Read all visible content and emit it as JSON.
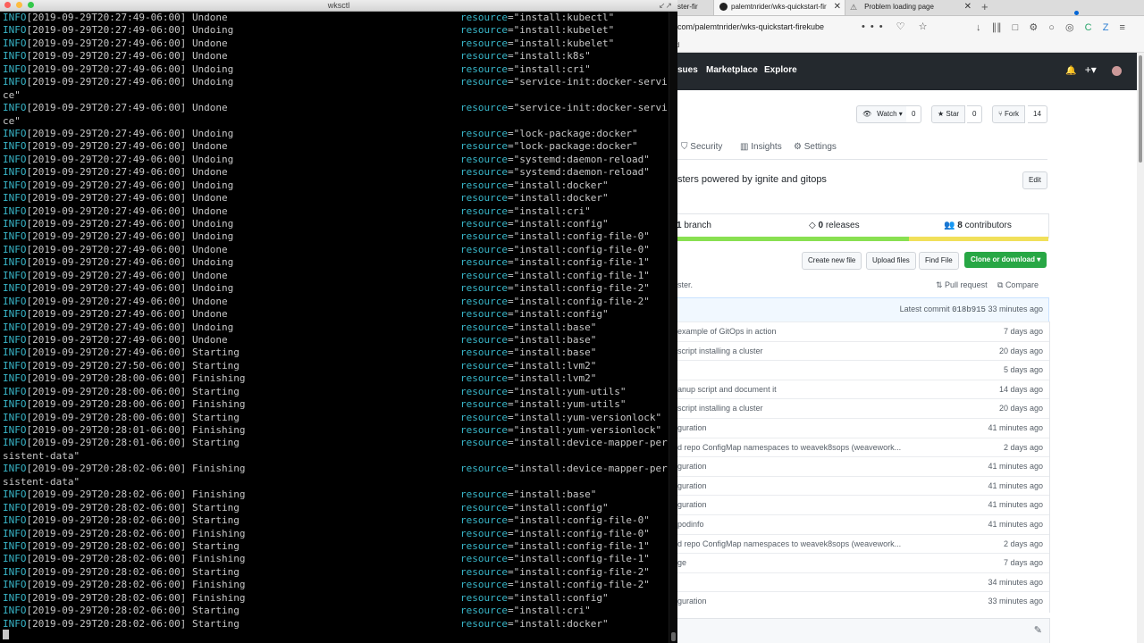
{
  "terminal": {
    "title": "wksctl",
    "resize_glyph": "↙↗",
    "lines": [
      {
        "level": "INFO",
        "ts": "[2019-09-29T20:27:49-06:00]",
        "msg": "Undone",
        "res_key": "resource",
        "res_val": "=\"install:kubectl\""
      },
      {
        "level": "INFO",
        "ts": "[2019-09-29T20:27:49-06:00]",
        "msg": "Undoing",
        "res_key": "resource",
        "res_val": "=\"install:kubelet\""
      },
      {
        "level": "INFO",
        "ts": "[2019-09-29T20:27:49-06:00]",
        "msg": "Undone",
        "res_key": "resource",
        "res_val": "=\"install:kubelet\""
      },
      {
        "level": "INFO",
        "ts": "[2019-09-29T20:27:49-06:00]",
        "msg": "Undone",
        "res_key": "resource",
        "res_val": "=\"install:k8s\""
      },
      {
        "level": "INFO",
        "ts": "[2019-09-29T20:27:49-06:00]",
        "msg": "Undoing",
        "res_key": "resource",
        "res_val": "=\"install:cri\""
      },
      {
        "level": "INFO",
        "ts": "[2019-09-29T20:27:49-06:00]",
        "msg": "Undoing",
        "res_key": "resource",
        "res_val": "=\"service-init:docker-servi"
      },
      {
        "level": "",
        "ts": "",
        "msg": "ce\"",
        "res_key": "",
        "res_val": ""
      },
      {
        "level": "INFO",
        "ts": "[2019-09-29T20:27:49-06:00]",
        "msg": "Undone",
        "res_key": "resource",
        "res_val": "=\"service-init:docker-servi"
      },
      {
        "level": "",
        "ts": "",
        "msg": "ce\"",
        "res_key": "",
        "res_val": ""
      },
      {
        "level": "INFO",
        "ts": "[2019-09-29T20:27:49-06:00]",
        "msg": "Undoing",
        "res_key": "resource",
        "res_val": "=\"lock-package:docker\""
      },
      {
        "level": "INFO",
        "ts": "[2019-09-29T20:27:49-06:00]",
        "msg": "Undone",
        "res_key": "resource",
        "res_val": "=\"lock-package:docker\""
      },
      {
        "level": "INFO",
        "ts": "[2019-09-29T20:27:49-06:00]",
        "msg": "Undoing",
        "res_key": "resource",
        "res_val": "=\"systemd:daemon-reload\""
      },
      {
        "level": "INFO",
        "ts": "[2019-09-29T20:27:49-06:00]",
        "msg": "Undone",
        "res_key": "resource",
        "res_val": "=\"systemd:daemon-reload\""
      },
      {
        "level": "INFO",
        "ts": "[2019-09-29T20:27:49-06:00]",
        "msg": "Undoing",
        "res_key": "resource",
        "res_val": "=\"install:docker\""
      },
      {
        "level": "INFO",
        "ts": "[2019-09-29T20:27:49-06:00]",
        "msg": "Undone",
        "res_key": "resource",
        "res_val": "=\"install:docker\""
      },
      {
        "level": "INFO",
        "ts": "[2019-09-29T20:27:49-06:00]",
        "msg": "Undone",
        "res_key": "resource",
        "res_val": "=\"install:cri\""
      },
      {
        "level": "INFO",
        "ts": "[2019-09-29T20:27:49-06:00]",
        "msg": "Undoing",
        "res_key": "resource",
        "res_val": "=\"install:config\""
      },
      {
        "level": "INFO",
        "ts": "[2019-09-29T20:27:49-06:00]",
        "msg": "Undoing",
        "res_key": "resource",
        "res_val": "=\"install:config-file-0\""
      },
      {
        "level": "INFO",
        "ts": "[2019-09-29T20:27:49-06:00]",
        "msg": "Undone",
        "res_key": "resource",
        "res_val": "=\"install:config-file-0\""
      },
      {
        "level": "INFO",
        "ts": "[2019-09-29T20:27:49-06:00]",
        "msg": "Undoing",
        "res_key": "resource",
        "res_val": "=\"install:config-file-1\""
      },
      {
        "level": "INFO",
        "ts": "[2019-09-29T20:27:49-06:00]",
        "msg": "Undone",
        "res_key": "resource",
        "res_val": "=\"install:config-file-1\""
      },
      {
        "level": "INFO",
        "ts": "[2019-09-29T20:27:49-06:00]",
        "msg": "Undoing",
        "res_key": "resource",
        "res_val": "=\"install:config-file-2\""
      },
      {
        "level": "INFO",
        "ts": "[2019-09-29T20:27:49-06:00]",
        "msg": "Undone",
        "res_key": "resource",
        "res_val": "=\"install:config-file-2\""
      },
      {
        "level": "INFO",
        "ts": "[2019-09-29T20:27:49-06:00]",
        "msg": "Undone",
        "res_key": "resource",
        "res_val": "=\"install:config\""
      },
      {
        "level": "INFO",
        "ts": "[2019-09-29T20:27:49-06:00]",
        "msg": "Undoing",
        "res_key": "resource",
        "res_val": "=\"install:base\""
      },
      {
        "level": "INFO",
        "ts": "[2019-09-29T20:27:49-06:00]",
        "msg": "Undone",
        "res_key": "resource",
        "res_val": "=\"install:base\""
      },
      {
        "level": "INFO",
        "ts": "[2019-09-29T20:27:49-06:00]",
        "msg": "Starting",
        "res_key": "resource",
        "res_val": "=\"install:base\""
      },
      {
        "level": "INFO",
        "ts": "[2019-09-29T20:27:50-06:00]",
        "msg": "Starting",
        "res_key": "resource",
        "res_val": "=\"install:lvm2\""
      },
      {
        "level": "INFO",
        "ts": "[2019-09-29T20:28:00-06:00]",
        "msg": "Finishing",
        "res_key": "resource",
        "res_val": "=\"install:lvm2\""
      },
      {
        "level": "INFO",
        "ts": "[2019-09-29T20:28:00-06:00]",
        "msg": "Starting",
        "res_key": "resource",
        "res_val": "=\"install:yum-utils\""
      },
      {
        "level": "INFO",
        "ts": "[2019-09-29T20:28:00-06:00]",
        "msg": "Finishing",
        "res_key": "resource",
        "res_val": "=\"install:yum-utils\""
      },
      {
        "level": "INFO",
        "ts": "[2019-09-29T20:28:00-06:00]",
        "msg": "Starting",
        "res_key": "resource",
        "res_val": "=\"install:yum-versionlock\""
      },
      {
        "level": "INFO",
        "ts": "[2019-09-29T20:28:01-06:00]",
        "msg": "Finishing",
        "res_key": "resource",
        "res_val": "=\"install:yum-versionlock\""
      },
      {
        "level": "INFO",
        "ts": "[2019-09-29T20:28:01-06:00]",
        "msg": "Starting",
        "res_key": "resource",
        "res_val": "=\"install:device-mapper-per"
      },
      {
        "level": "",
        "ts": "",
        "msg": "sistent-data\"",
        "res_key": "",
        "res_val": ""
      },
      {
        "level": "INFO",
        "ts": "[2019-09-29T20:28:02-06:00]",
        "msg": "Finishing",
        "res_key": "resource",
        "res_val": "=\"install:device-mapper-per"
      },
      {
        "level": "",
        "ts": "",
        "msg": "sistent-data\"",
        "res_key": "",
        "res_val": ""
      },
      {
        "level": "INFO",
        "ts": "[2019-09-29T20:28:02-06:00]",
        "msg": "Finishing",
        "res_key": "resource",
        "res_val": "=\"install:base\""
      },
      {
        "level": "INFO",
        "ts": "[2019-09-29T20:28:02-06:00]",
        "msg": "Starting",
        "res_key": "resource",
        "res_val": "=\"install:config\""
      },
      {
        "level": "INFO",
        "ts": "[2019-09-29T20:28:02-06:00]",
        "msg": "Starting",
        "res_key": "resource",
        "res_val": "=\"install:config-file-0\""
      },
      {
        "level": "INFO",
        "ts": "[2019-09-29T20:28:02-06:00]",
        "msg": "Finishing",
        "res_key": "resource",
        "res_val": "=\"install:config-file-0\""
      },
      {
        "level": "INFO",
        "ts": "[2019-09-29T20:28:02-06:00]",
        "msg": "Starting",
        "res_key": "resource",
        "res_val": "=\"install:config-file-1\""
      },
      {
        "level": "INFO",
        "ts": "[2019-09-29T20:28:02-06:00]",
        "msg": "Finishing",
        "res_key": "resource",
        "res_val": "=\"install:config-file-1\""
      },
      {
        "level": "INFO",
        "ts": "[2019-09-29T20:28:02-06:00]",
        "msg": "Starting",
        "res_key": "resource",
        "res_val": "=\"install:config-file-2\""
      },
      {
        "level": "INFO",
        "ts": "[2019-09-29T20:28:02-06:00]",
        "msg": "Finishing",
        "res_key": "resource",
        "res_val": "=\"install:config-file-2\""
      },
      {
        "level": "INFO",
        "ts": "[2019-09-29T20:28:02-06:00]",
        "msg": "Finishing",
        "res_key": "resource",
        "res_val": "=\"install:config\""
      },
      {
        "level": "INFO",
        "ts": "[2019-09-29T20:28:02-06:00]",
        "msg": "Starting",
        "res_key": "resource",
        "res_val": "=\"install:cri\""
      },
      {
        "level": "INFO",
        "ts": "[2019-09-29T20:28:02-06:00]",
        "msg": "Starting",
        "res_key": "resource",
        "res_val": "=\"install:docker\""
      }
    ],
    "colors": {
      "background": "#000000",
      "text": "#c7c7c7",
      "accent": "#38b6c9"
    }
  },
  "browser": {
    "tabs": [
      {
        "label": "ster-fir",
        "icon": "tab-icon"
      },
      {
        "label": "palemtnrider/wks-quickstart-fir",
        "icon": "github-icon"
      },
      {
        "label": "Problem loading page",
        "icon": "warning-icon"
      }
    ],
    "tab_close": "✕",
    "new_tab": "+",
    "url": "com/palemtnrider/wks-quickstart-firekube",
    "url_actions": [
      "•••",
      "♡",
      "☆"
    ],
    "nav_icons": [
      "↓",
      "∥∥",
      "□",
      "⚙",
      "○",
      "◎",
      "C",
      "Z",
      "≡"
    ],
    "bookmarks_label": "d",
    "gh_nav": [
      "sues",
      "Marketplace",
      "Explore"
    ],
    "gh_right": [
      "🔔",
      "+▾",
      "▾"
    ],
    "watch": {
      "label": "Watch ▾",
      "count": "0"
    },
    "star": {
      "label": "★ Star",
      "count": "0"
    },
    "fork": {
      "label": "⑂ Fork",
      "count": "14"
    },
    "repo_tabs": [
      "Security",
      "Insights",
      "Settings"
    ],
    "description": "sters powered by ignite and gitops",
    "edit_label": "Edit",
    "summary": {
      "branch_num": "1",
      "branch_word": "branch",
      "releases_num": "0",
      "releases_word": "releases",
      "contributors_num": "8",
      "contributors_word": "contributors"
    },
    "file_buttons": [
      "Create new file",
      "Upload files",
      "Find File"
    ],
    "clone_label": "Clone or download ▾",
    "aster_text": "ster.",
    "pull_request": "Pull request",
    "compare": "Compare",
    "latest_label": "Latest commit",
    "latest_sha": "018b915",
    "latest_age": "33 minutes ago",
    "files": [
      {
        "msg": "example of GitOps in action",
        "age": "7 days ago"
      },
      {
        "msg": "script installing a cluster",
        "age": "20 days ago"
      },
      {
        "msg": "",
        "age": "5 days ago"
      },
      {
        "msg": "anup script and document it",
        "age": "14 days ago"
      },
      {
        "msg": "script installing a cluster",
        "age": "20 days ago"
      },
      {
        "msg": "guration",
        "age": "41 minutes ago"
      },
      {
        "msg": "d repo ConfigMap namespaces to weavek8sops (weavework...",
        "age": "2 days ago"
      },
      {
        "msg": "guration",
        "age": "41 minutes ago"
      },
      {
        "msg": "guration",
        "age": "41 minutes ago"
      },
      {
        "msg": "guration",
        "age": "41 minutes ago"
      },
      {
        "msg": "podinfo",
        "age": "41 minutes ago"
      },
      {
        "msg": "d repo ConfigMap namespaces to weavek8sops (weavework...",
        "age": "2 days ago"
      },
      {
        "msg": "ge",
        "age": "7 days ago"
      },
      {
        "msg": "",
        "age": "34 minutes ago"
      },
      {
        "msg": "guration",
        "age": "33 minutes ago"
      }
    ],
    "pencil": "✎",
    "colors": {
      "gh_header": "#24292e",
      "green": "#28a745",
      "link_bar": "#f1f8ff",
      "lang_green": "#89e051",
      "lang_yellow": "#f1e05a"
    }
  }
}
